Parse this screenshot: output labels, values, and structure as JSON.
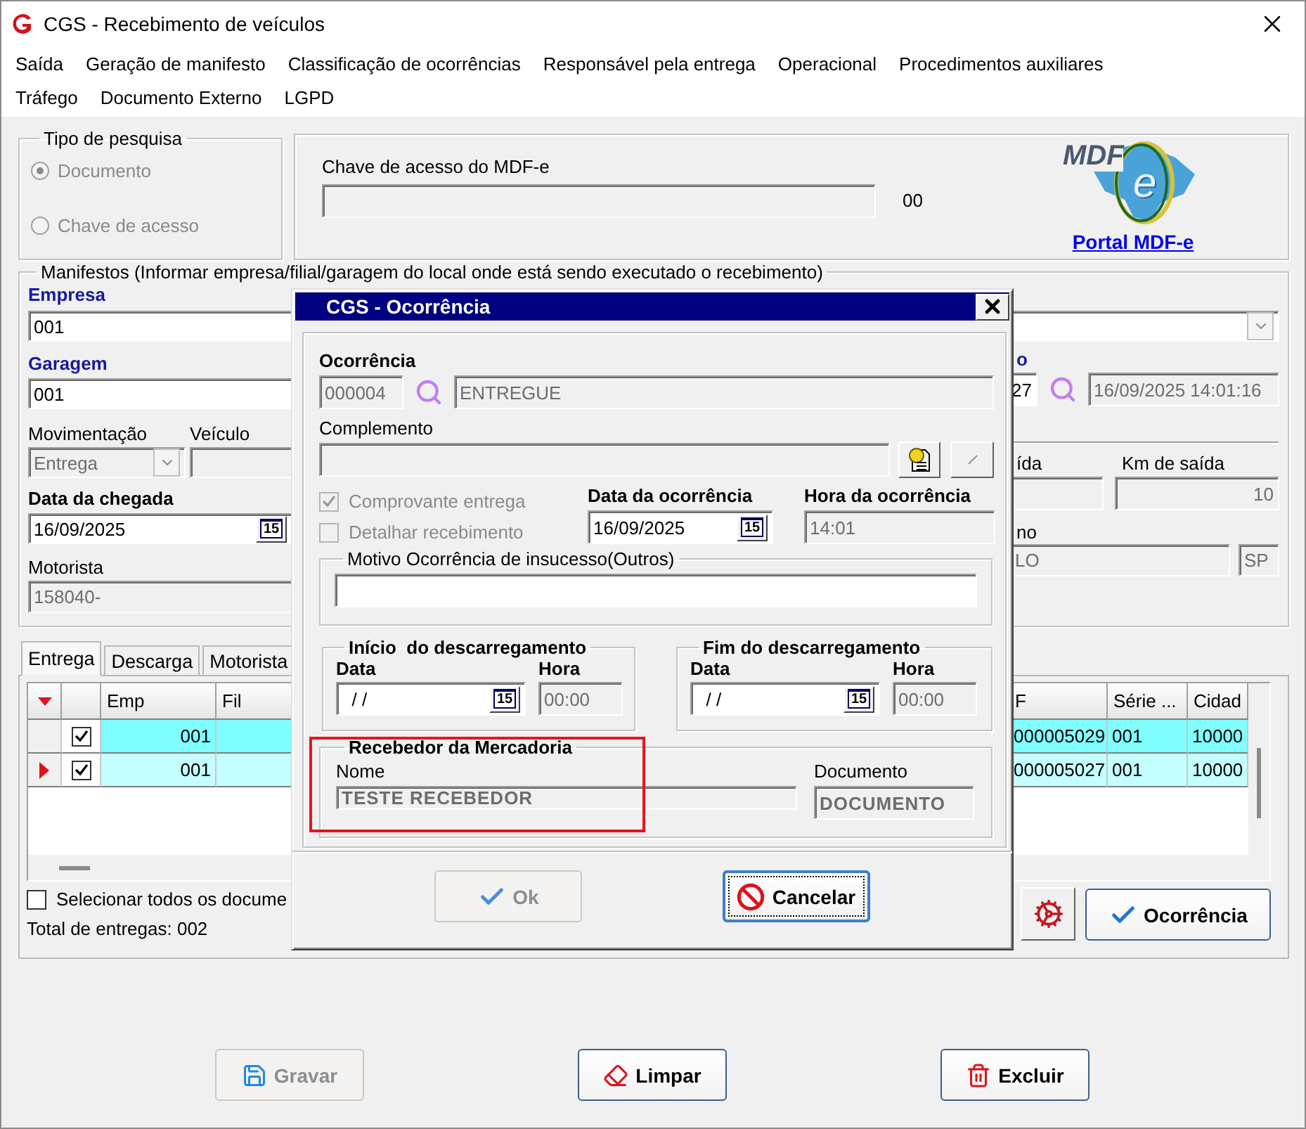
{
  "window": {
    "title": "CGS - Recebimento de veículos"
  },
  "menu": [
    "Saída",
    "Geração de manifesto",
    "Classificação de ocorrências",
    "Responsável pela entrega",
    "Operacional",
    "Procedimentos auxiliares",
    "Tráfego",
    "Documento Externo",
    "LGPD"
  ],
  "search_type": {
    "title": "Tipo de pesquisa",
    "disabled": true,
    "options": [
      {
        "label": "Documento",
        "selected": true
      },
      {
        "label": "Chave de acesso",
        "selected": false
      }
    ]
  },
  "mdfe_key": {
    "label": "Chave de acesso do MDF-e",
    "suffix": "00",
    "logo_wordmark": "MDF",
    "logo_letter": "e",
    "portal_link": "Portal MDF-e"
  },
  "manifests": {
    "title": "Manifestos (Informar empresa/filial/garagem do local onde está sendo executado o recebimento)",
    "empresa": {
      "label": "Empresa",
      "value": "001"
    },
    "garagem": {
      "label": "Garagem",
      "value": "001"
    },
    "movimentacao": {
      "label": "Movimentação",
      "value": "Entrega"
    },
    "veiculo": {
      "label": "Veículo"
    },
    "data_chegada": {
      "label": "Data da chegada",
      "value": "16/09/2025",
      "calendar": "15"
    },
    "motorista": {
      "label": "Motorista",
      "value": "158040-"
    },
    "right": {
      "label_1": "o",
      "number": "27",
      "datetime": "16/09/2025 14:01:16",
      "label_2": "ída",
      "km_label": "Km de saída",
      "km_value": "10",
      "label_3": "no",
      "city": "LO",
      "state": "SP"
    }
  },
  "tabs": [
    {
      "label": "Entrega",
      "selected": true
    },
    {
      "label": "Descarga",
      "selected": false
    },
    {
      "label": "Motorista",
      "selected": false
    }
  ],
  "grid": {
    "columns": [
      "Emp",
      "Fil",
      "F",
      "Série ...",
      "Cidad"
    ],
    "rows": [
      {
        "selected": false,
        "checked": true,
        "cells": [
          "001",
          "",
          "000005029",
          "001",
          "10000"
        ]
      },
      {
        "selected": true,
        "checked": true,
        "cells": [
          "001",
          "",
          "000005027",
          "001",
          "10000"
        ]
      }
    ]
  },
  "select_all": {
    "label": "Selecionar todos os docume",
    "checked": false
  },
  "total": "Total de entregas: 002",
  "occurrence_button": "Ocorrência",
  "footer_buttons": [
    {
      "label": "Gravar",
      "kind": "save",
      "disabled": true
    },
    {
      "label": "Limpar",
      "kind": "clear",
      "disabled": false
    },
    {
      "label": "Excluir",
      "kind": "delete",
      "disabled": false
    }
  ],
  "dialog": {
    "title": "CGS - Ocorrência",
    "ocorrencia": {
      "label": "Ocorrência",
      "code": "000004",
      "description": "ENTREGUE"
    },
    "complemento": {
      "label": "Complemento"
    },
    "checkboxes": [
      {
        "label": "Comprovante entrega",
        "checked": true,
        "disabled": true
      },
      {
        "label": "Detalhar recebimento",
        "checked": false,
        "disabled": true
      }
    ],
    "data": {
      "label": "Data da ocorrência",
      "value": "16/09/2025",
      "calendar": "15"
    },
    "hora": {
      "label": "Hora da ocorrência",
      "value": "14:01"
    },
    "motivo": {
      "title": "Motivo Ocorrência de insucesso(Outros)"
    },
    "unload": [
      {
        "title": "Início  do descarregamento",
        "date_label": "Data",
        "date": "/ /",
        "calendar": "15",
        "time_label": "Hora",
        "time": "00:00"
      },
      {
        "title": "Fim do descarregamento",
        "date_label": "Data",
        "date": "/ /",
        "calendar": "15",
        "time_label": "Hora",
        "time": "00:00"
      }
    ],
    "receiver": {
      "title": "Recebedor da Mercadoria",
      "highlighted": true,
      "name_label": "Nome",
      "name": "TESTE RECEBEDOR",
      "doc_label": "Documento",
      "doc": "DOCUMENTO"
    },
    "buttons": [
      {
        "label": "Ok",
        "kind": "ok",
        "disabled": true,
        "focused": false
      },
      {
        "label": "Cancelar",
        "kind": "cancel",
        "disabled": false,
        "focused": true
      }
    ]
  }
}
